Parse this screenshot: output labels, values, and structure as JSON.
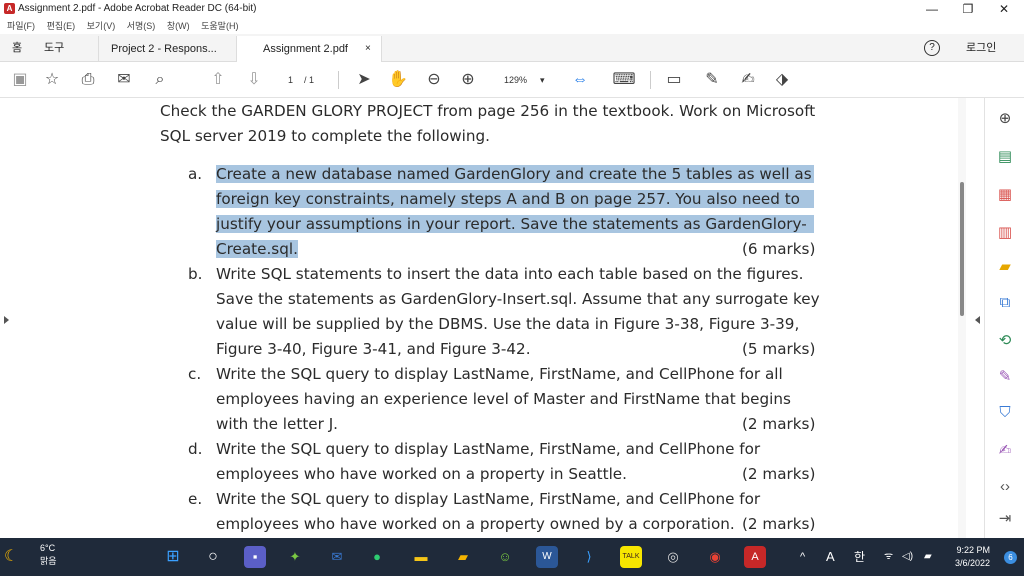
{
  "window": {
    "title": "Assignment 2.pdf - Adobe Acrobat Reader DC (64-bit)",
    "app_icon": "acrobat-icon",
    "minimize": "—",
    "maximize": "❐",
    "close": "✕"
  },
  "menu": [
    "파일(F)",
    "편집(E)",
    "보기(V)",
    "서명(S)",
    "창(W)",
    "도움말(H)"
  ],
  "tabs": {
    "home": "홈",
    "tools": "도구",
    "doc1": "Project 2 - Respons...",
    "doc2": "Assignment 2.pdf",
    "doc2_close": "×"
  },
  "topright": {
    "help": "?",
    "login": "로그인"
  },
  "toolbar": {
    "page_current": "1",
    "page_total": "/ 1",
    "zoom": "129%",
    "zoom_arrow": "▾"
  },
  "document": {
    "intro_line1": "Check the GARDEN GLORY PROJECT from page 256 in the textbook. Work on Microsoft",
    "intro_line2": "SQL server 2019 to complete the following.",
    "items": [
      {
        "letter": "a.",
        "lines": [
          "Create a new database named GardenGlory and create the 5 tables as well as",
          "foreign key constraints, namely steps A and B on page 257. You also need to",
          "justify your assumptions in your report. Save the statements as GardenGlory-",
          "Create.sql."
        ],
        "marks": "(6 marks)"
      },
      {
        "letter": "b.",
        "lines": [
          "Write SQL statements to insert the data into each table based on the figures.",
          "Save the statements as GardenGlory-Insert.sql. Assume that any surrogate key",
          "value will be supplied by the DBMS. Use the data in Figure 3-38, Figure 3-39,",
          "Figure 3-40, Figure 3-41, and Figure 3-42."
        ],
        "marks": "(5 marks)"
      },
      {
        "letter": "c.",
        "lines": [
          "Write the SQL query to display LastName, FirstName, and CellPhone for all",
          "employees having an experience level of Master and FirstName that begins",
          "with the letter J."
        ],
        "marks": "(2 marks)"
      },
      {
        "letter": "d.",
        "lines": [
          "Write the SQL query to display LastName, FirstName, and CellPhone for",
          "employees who have worked on a property in Seattle."
        ],
        "marks": "(2 marks)"
      },
      {
        "letter": "e.",
        "lines": [
          "Write the SQL query to display LastName, FirstName, and CellPhone for",
          "employees who have worked on a property owned by a corporation."
        ],
        "marks": "(2 marks)"
      }
    ]
  },
  "taskbar": {
    "weather_temp": "6°C",
    "weather_desc": "맑음",
    "tray_caret": "^",
    "ime_a": "A",
    "ime_han": "한",
    "time": "9:22 PM",
    "date": "3/6/2022",
    "notifications": "6"
  },
  "colors": {
    "highlight": "#a8c5e0",
    "acrobat_red": "#c62828",
    "link_blue": "#1473e6",
    "taskbar": "#1f2a3a"
  }
}
